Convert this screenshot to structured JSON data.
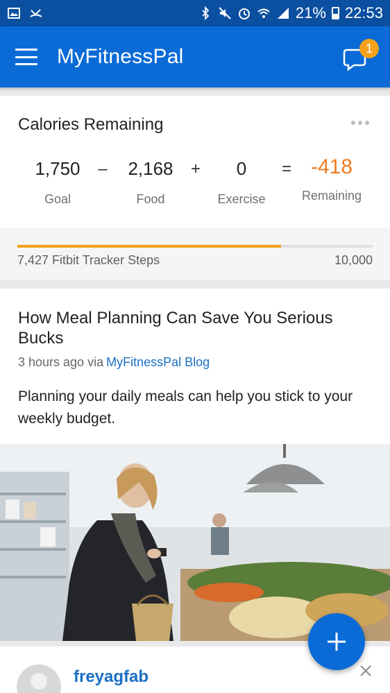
{
  "status_bar": {
    "battery": "21%",
    "time": "22:53"
  },
  "app_bar": {
    "title": "MyFitnessPal",
    "notification_count": "1"
  },
  "calories": {
    "title": "Calories Remaining",
    "goal_value": "1,750",
    "goal_label": "Goal",
    "minus": "–",
    "food_value": "2,168",
    "food_label": "Food",
    "plus": "+",
    "exercise_value": "0",
    "exercise_label": "Exercise",
    "equals": "=",
    "remaining_value": "-418",
    "remaining_label": "Remaining"
  },
  "steps": {
    "label": "7,427 Fitbit Tracker Steps",
    "goal": "10,000",
    "progress_fraction": 0.7427
  },
  "article": {
    "title": "How Meal Planning Can Save You Serious Bucks",
    "time_ago": "3 hours ago via",
    "source": "MyFitnessPal Blog",
    "description": "Planning your daily meals can help you stick to your weekly budget."
  },
  "post": {
    "username": "freyagfab"
  },
  "colors": {
    "primary": "#0a6bd6",
    "status_bar": "#0b4fa0",
    "accent_orange": "#ef7a1f",
    "progress": "#f5a01c",
    "link": "#1a6fc6"
  }
}
